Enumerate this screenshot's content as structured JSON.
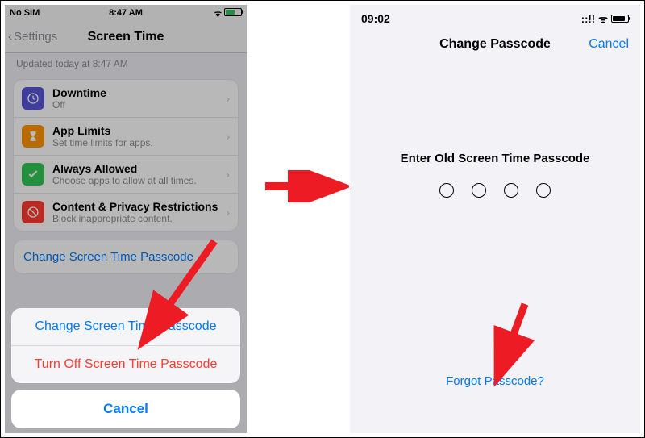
{
  "left": {
    "statusbar": {
      "carrier": "No SIM",
      "time": "8:47 AM",
      "wifi": "ᯤ"
    },
    "nav": {
      "back": "Settings",
      "title": "Screen Time"
    },
    "updated": "Updated today at 8:47 AM",
    "items": [
      {
        "title": "Downtime",
        "sub": "Off"
      },
      {
        "title": "App Limits",
        "sub": "Set time limits for apps."
      },
      {
        "title": "Always Allowed",
        "sub": "Choose apps to allow at all times."
      },
      {
        "title": "Content & Privacy Restrictions",
        "sub": "Block inappropriate content."
      }
    ],
    "change_link": "Change Screen Time Passcode",
    "sheet": {
      "change": "Change Screen Time Passcode",
      "turnoff": "Turn Off Screen Time Passcode",
      "cancel": "Cancel"
    }
  },
  "right": {
    "statusbar": {
      "time": "09:02"
    },
    "nav": {
      "title": "Change Passcode",
      "cancel": "Cancel"
    },
    "prompt": "Enter Old Screen Time Passcode",
    "forgot": "Forgot Passcode?"
  }
}
